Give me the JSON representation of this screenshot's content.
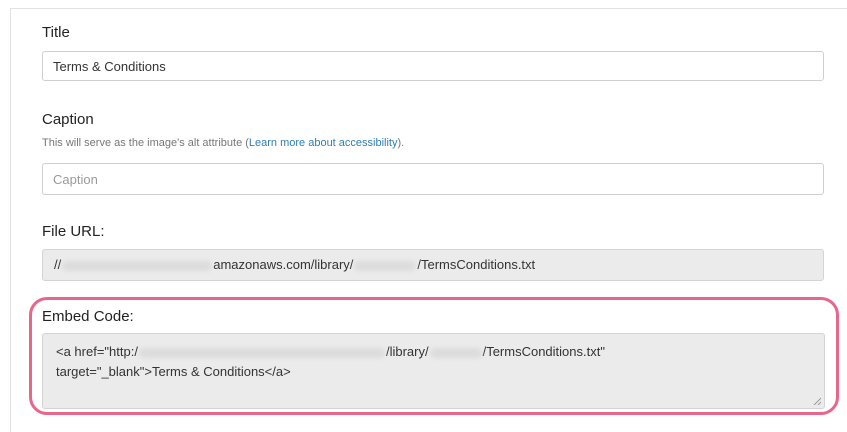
{
  "title_field": {
    "label": "Title",
    "value": "Terms & Conditions"
  },
  "caption_field": {
    "label": "Caption",
    "help_prefix": "This will serve as the image's alt attribute (",
    "help_link": "Learn more about accessibility",
    "help_suffix": ").",
    "placeholder": "Caption"
  },
  "file_url": {
    "label": "File URL:",
    "prefix": "//",
    "domain_fragment": "amazonaws.com/library/",
    "filename": "/TermsConditions.txt"
  },
  "embed_code": {
    "label": "Embed Code:",
    "line1_start": "<a href=\"http:/",
    "line1_mid": "/library/",
    "line1_end": "/TermsConditions.txt\"",
    "line2": "target=\"_blank\">Terms & Conditions</a>",
    "highlight_color": "#e8668a"
  }
}
